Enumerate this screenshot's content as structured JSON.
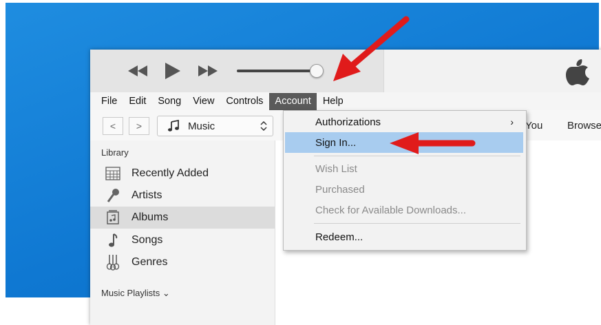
{
  "menubar": {
    "items": [
      {
        "label": "File"
      },
      {
        "label": "Edit"
      },
      {
        "label": "Song"
      },
      {
        "label": "View"
      },
      {
        "label": "Controls"
      },
      {
        "label": "Account",
        "active": true
      },
      {
        "label": "Help"
      }
    ]
  },
  "navbar": {
    "back_label": "<",
    "forward_label": ">",
    "media_selector": "Music",
    "right_tabs": [
      "You",
      "Browse"
    ]
  },
  "sidebar": {
    "library_heading": "Library",
    "items": [
      {
        "label": "Recently Added",
        "icon": "calendar-grid-icon"
      },
      {
        "label": "Artists",
        "icon": "microphone-icon"
      },
      {
        "label": "Albums",
        "icon": "album-icon",
        "selected": true
      },
      {
        "label": "Songs",
        "icon": "music-note-icon"
      },
      {
        "label": "Genres",
        "icon": "guitars-icon"
      }
    ],
    "playlists_heading": "Music Playlists",
    "playlists_chevron": "⌄"
  },
  "account_menu": {
    "items": [
      {
        "label": "Authorizations",
        "has_submenu": true,
        "submenu_glyph": "›"
      },
      {
        "label": "Sign In...",
        "highlighted": true
      },
      {
        "label": "Wish List",
        "disabled": true
      },
      {
        "label": "Purchased",
        "disabled": true
      },
      {
        "label": "Check for Available Downloads...",
        "disabled": true
      },
      {
        "label": "Redeem..."
      }
    ]
  },
  "colors": {
    "desktop_blue": "#1283dc",
    "highlight": "#a8ccef",
    "annotation_arrow": "#e01b1b"
  }
}
